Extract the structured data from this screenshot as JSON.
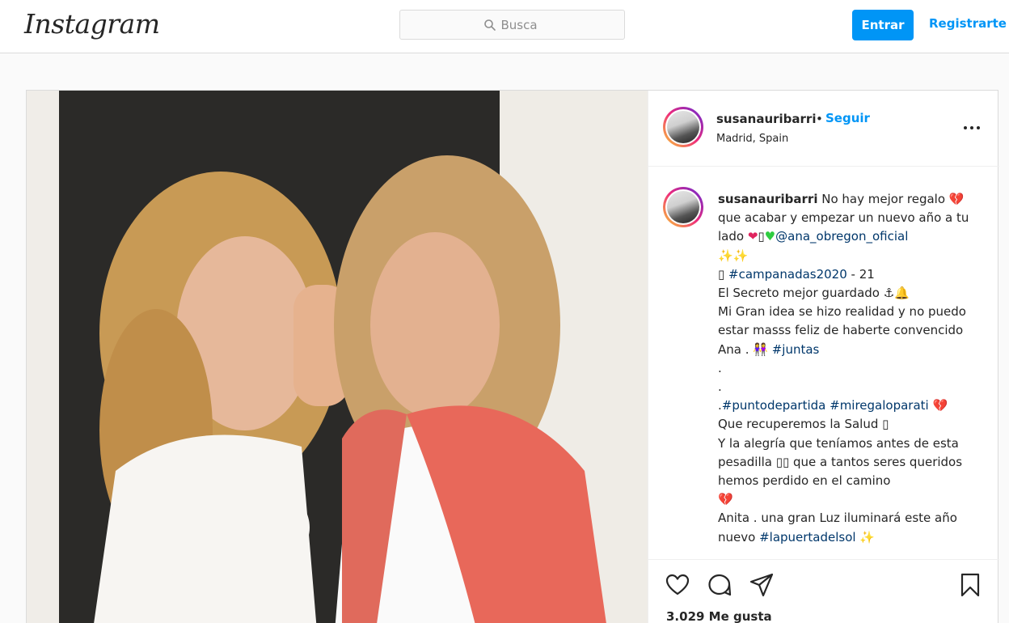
{
  "app": {
    "logo": "Instagram"
  },
  "search": {
    "placeholder": "Busca"
  },
  "nav": {
    "login_label": "Entrar",
    "signup_label": "Registrarte"
  },
  "post": {
    "username": "susanauribarri",
    "separator": "•",
    "follow_label": "Seguir",
    "location": "Madrid, Spain",
    "caption": {
      "username": "susanauribarri",
      "line1": " No hay mejor regalo ",
      "line2": "que acabar y empezar un nuevo año a tu lado ",
      "mention": "@ana_obregon_oficial",
      "tag1": "#campanadas2020",
      "after_tag1": " - 21",
      "line3": "El Secreto mejor guardado ",
      "line4": "Mi Gran idea se hizo realidad y no puedo estar masss feliz de haberte convencido Ana . ",
      "tag2": "#juntas",
      "dot1": ".",
      "dot2": ".",
      "dot3": ".",
      "tag3": "#puntodepartida",
      "tag4": "#miregaloparati",
      "line5": "Que recuperemos la Salud ",
      "line6": "Y la alegría que teníamos antes de esta pesadilla ",
      "line7": " que a tantos seres queridos hemos perdido en el camino",
      "line8": "Anita . una gran Luz iluminará este año nuevo ",
      "tag5": "#lapuertadelsol"
    },
    "likes": "3.029 Me gusta"
  },
  "icons": {
    "search": "search-icon",
    "more": "more-options-icon",
    "like": "heart-icon",
    "comment": "comment-icon",
    "share": "paper-plane-icon",
    "save": "bookmark-icon"
  },
  "colors": {
    "accent": "#0095f6",
    "hashtag": "#00376b",
    "border": "#dbdbdb"
  }
}
